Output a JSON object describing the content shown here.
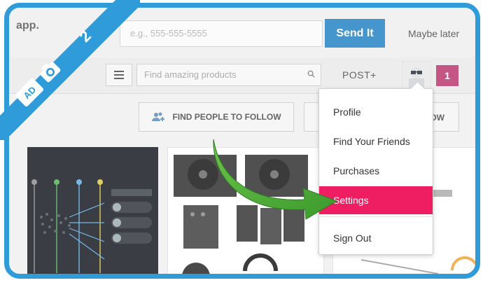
{
  "topbar": {
    "app_text": "app.",
    "phone_placeholder": "e.g., 555-555-5555",
    "send_label": "Send It",
    "maybe_later": "Maybe later"
  },
  "navbar": {
    "search_placeholder": "Find amazing products",
    "post_label": "POST+",
    "notification_count": "1"
  },
  "actions": {
    "find_people_label": "FIND PEOPLE TO FOLLOW",
    "second_button_fragment": "OW"
  },
  "dropdown": {
    "items": [
      {
        "label": "Profile"
      },
      {
        "label": "Find Your Friends"
      },
      {
        "label": "Purchases"
      },
      {
        "label": "Settings"
      },
      {
        "label": "Sign Out"
      }
    ],
    "active_index": 3
  },
  "badge": {
    "step": "2"
  },
  "colors": {
    "frame_blue": "#2f9bd9",
    "send_blue": "#1d7fc2",
    "settings_pink": "#ef1e63",
    "notif_magenta": "#b8306a",
    "arrow_green": "#4caf3a"
  },
  "icons": [
    "menu-icon",
    "search-icon",
    "avatar-icon",
    "add-people-icon",
    "camera-icon",
    "curved-arrow-icon"
  ]
}
